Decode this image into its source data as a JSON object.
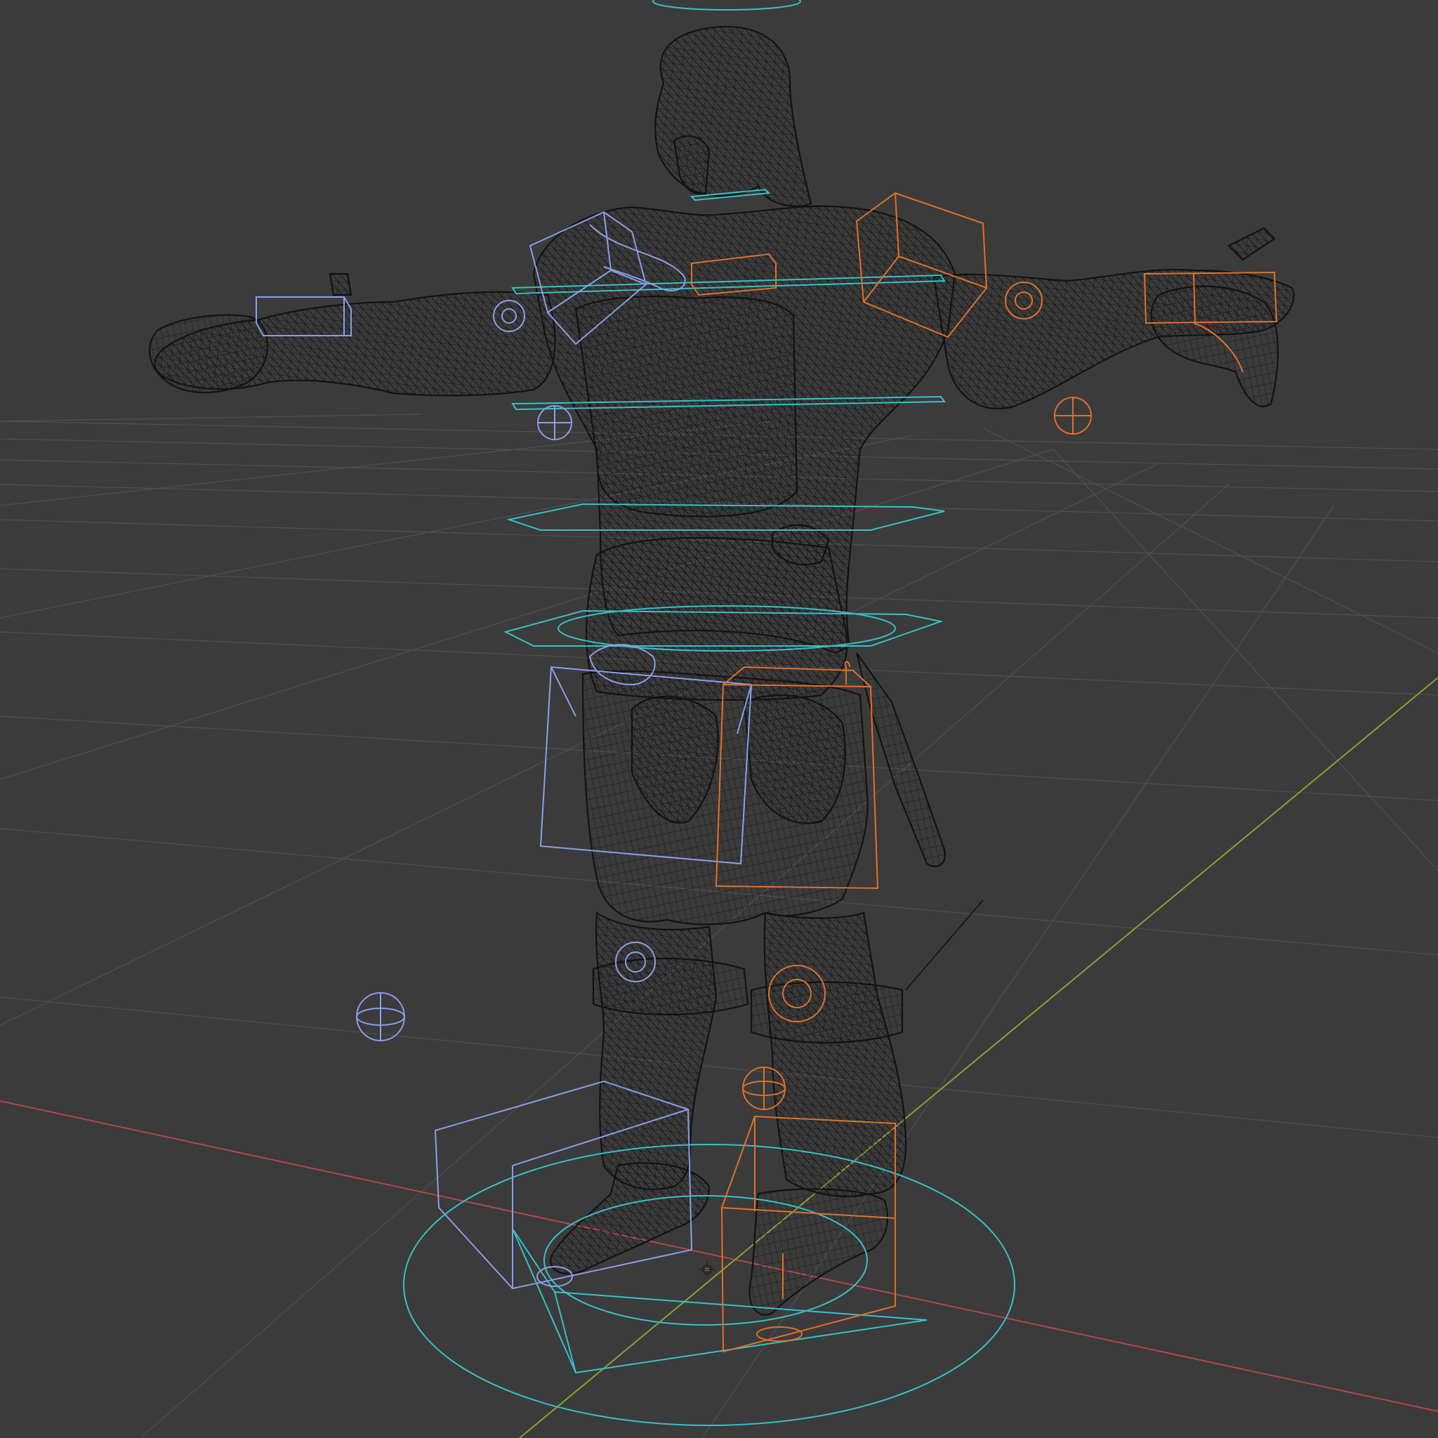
{
  "viewport": {
    "editor": "3D Viewport",
    "shading": "wireframe",
    "background_color": "#3b3b3b"
  },
  "scene": {
    "mesh_name": "character-mesh",
    "mesh_wire_color": "#151515",
    "grid_color": "#545454",
    "x_axis_color": "#b5474b",
    "y_axis_color": "#8ba032",
    "center_controls_color": "#38c0c8",
    "left_controls_color": "#8a9ee8",
    "right_controls_color": "#e0702a",
    "origin_color": "#e8a030"
  }
}
